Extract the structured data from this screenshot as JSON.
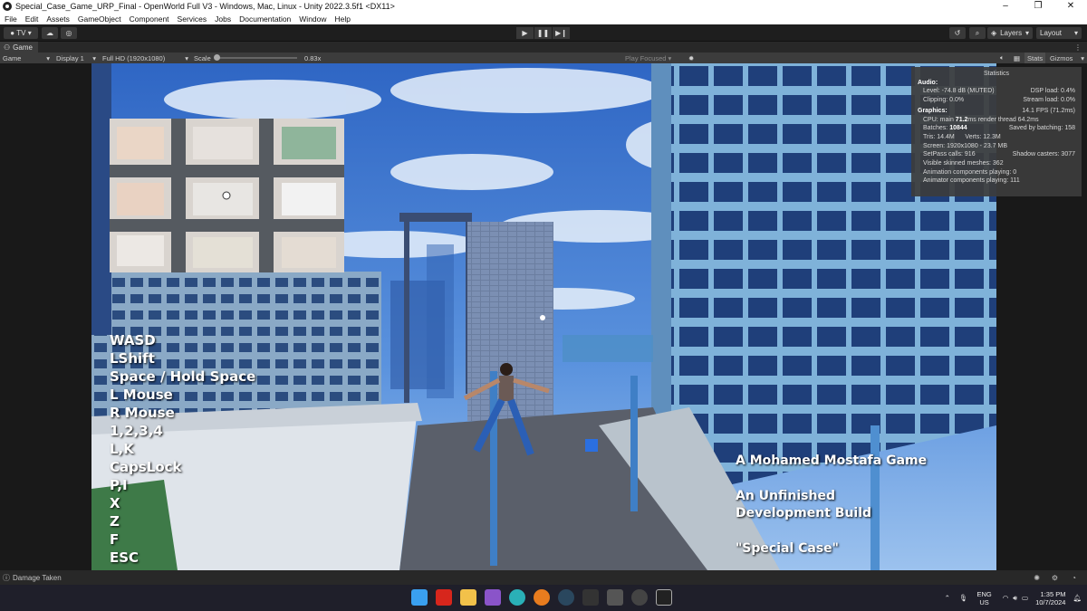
{
  "window": {
    "title": "Special_Case_Game_URP_Final - OpenWorld Full V3 - Windows, Mac, Linux - Unity 2022.3.5f1 <DX11>",
    "controls": [
      "–",
      "❐",
      "✕"
    ]
  },
  "menu": [
    "File",
    "Edit",
    "Assets",
    "GameObject",
    "Component",
    "Services",
    "Jobs",
    "Documentation",
    "Window",
    "Help"
  ],
  "toolbar": {
    "account_label": "TV",
    "layers_label": "Layers",
    "layout_label": "Layout"
  },
  "game_tab": {
    "label": "Game",
    "mode": "Game",
    "display": "Display 1",
    "resolution": "Full HD (1920x1080)",
    "scale_label": "Scale",
    "scale_value": "0.83x",
    "play_focused": "Play Focused",
    "stats_label": "Stats",
    "gizmos_label": "Gizmos"
  },
  "overlay": {
    "controls": [
      "WASD",
      "LShift",
      "Space / Hold Space",
      "L Mouse",
      "R Mouse",
      "1,2,3,4",
      "L,K",
      "CapsLock",
      "P,I",
      "X",
      "Z",
      "F",
      "ESC"
    ],
    "credit_author": "A Mohamed Mostafa Game",
    "credit_build_1": "An Unfinished",
    "credit_build_2": "Development Build",
    "credit_title": "\"Special Case\""
  },
  "stats": {
    "title": "Statistics",
    "audio_header": "Audio:",
    "level": "Level: -74.8 dB (MUTED)",
    "dsp_load": "DSP load: 0.4%",
    "clipping": "Clipping: 0.0%",
    "stream_load": "Stream load: 0.0%",
    "graphics_header": "Graphics:",
    "fps": "14.1 FPS (71.2ms)",
    "cpu_prefix": "CPU: main",
    "cpu_main": "71.2",
    "cpu_suffix": "ms  render thread 64.2ms",
    "batches_prefix": "Batches:",
    "batches": "10844",
    "saved_batching": "Saved by batching: 158",
    "tris": "Tris: 14.4M",
    "verts": "Verts: 12.3M",
    "screen": "Screen: 1920x1080 - 23.7 MB",
    "setpass": "SetPass calls: 916",
    "shadow_casters": "Shadow casters: 3077",
    "skinned": "Visible skinned meshes: 362",
    "anim_components": "Animation components playing: 0",
    "animator_components": "Animator components playing: 111"
  },
  "status": {
    "message": "Damage Taken"
  },
  "tray": {
    "lang_1": "ENG",
    "lang_2": "US",
    "time": "1:35 PM",
    "date": "10/7/2024"
  },
  "colors": {
    "accent": "#4a6fa5",
    "editor_bg": "#191919",
    "sky": "#4a7fd0"
  }
}
